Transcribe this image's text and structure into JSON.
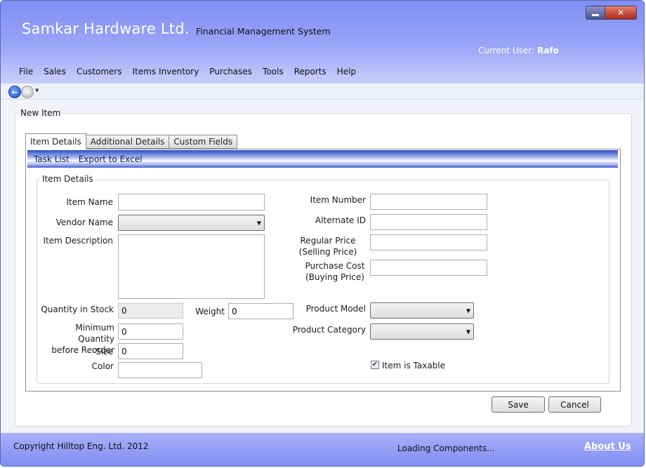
{
  "header": {
    "app_title": "Samkar Hardware Ltd.",
    "app_subtitle": "Financial Management System",
    "current_user_label": "Current User:",
    "current_user_name": "Rafo"
  },
  "window_controls": {
    "minimize": "minimize-icon",
    "close": "close-icon",
    "close_glyph": "✕"
  },
  "menu": [
    "File",
    "Sales",
    "Customers",
    "Items Inventory",
    "Purchases",
    "Tools",
    "Reports",
    "Help"
  ],
  "nav": {
    "back": "back-arrow-icon",
    "forward": "forward-arrow-icon",
    "dropdown": "chevron-down-icon"
  },
  "panel": {
    "legend": "New Item"
  },
  "tabs": [
    {
      "label": "Item Details",
      "active": true
    },
    {
      "label": "Additional Details",
      "active": false
    },
    {
      "label": "Custom Fields",
      "active": false
    }
  ],
  "toolbar": {
    "task_list": "Task List",
    "export": "Export to Excel"
  },
  "form": {
    "group_legend": "Item Details",
    "item_name": {
      "label": "Item Name",
      "value": ""
    },
    "vendor_name": {
      "label": "Vendor Name",
      "value": ""
    },
    "item_description": {
      "label": "Item Description",
      "value": ""
    },
    "quantity_in_stock": {
      "label": "Quantity in Stock",
      "value": "0"
    },
    "weight": {
      "label": "Weight",
      "value": "0"
    },
    "min_quantity": {
      "label_line1": "Minimum Quantity",
      "label_line2": "before Reorder",
      "value": "0"
    },
    "size": {
      "label": "Size",
      "value": "0"
    },
    "color": {
      "label": "Color",
      "value": ""
    },
    "item_number": {
      "label": "Item Number",
      "value": ""
    },
    "alternate_id": {
      "label": "Alternate ID",
      "value": ""
    },
    "regular_price": {
      "label_line1": "Regular Price",
      "label_line2": "(Selling Price)",
      "value": ""
    },
    "purchase_cost": {
      "label_line1": "Purchase Cost",
      "label_line2": "(Buying Price)",
      "value": ""
    },
    "product_model": {
      "label": "Product Model",
      "value": ""
    },
    "product_category": {
      "label": "Product Category",
      "value": ""
    },
    "taxable": {
      "label": "Item is Taxable",
      "checked": true,
      "glyph": "✔"
    }
  },
  "buttons": {
    "save": "Save",
    "cancel": "Cancel"
  },
  "footer": {
    "copyright": "Copyright Hilltop Eng. Ltd. 2012",
    "status": "Loading Components...",
    "about": "About Us"
  },
  "colors": {
    "header_accent": "#8a97f6",
    "footer_accent": "#8d98f5"
  }
}
